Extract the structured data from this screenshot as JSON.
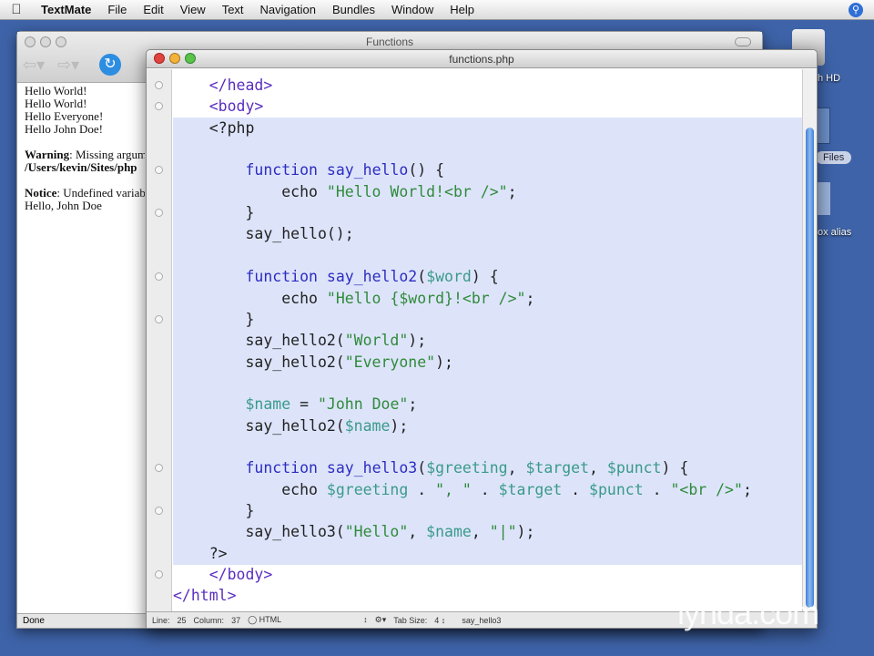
{
  "menubar": {
    "apple": "",
    "app": "TextMate",
    "items": [
      "File",
      "Edit",
      "View",
      "Text",
      "Navigation",
      "Bundles",
      "Window",
      "Help"
    ]
  },
  "desktop": {
    "hd_label": "h HD",
    "files_label": "Files",
    "alias_label": "ox alias"
  },
  "browser": {
    "title": "Functions",
    "status": "Done",
    "lines": [
      "Hello World!",
      "Hello World!",
      "Hello Everyone!",
      "Hello John Doe!"
    ],
    "warning_label": "Warning",
    "warning_text": ": Missing argument",
    "warning_path": "/Users/kevin/Sites/php",
    "notice_label": "Notice",
    "notice_text": ": Undefined variable",
    "final": "Hello, John Doe"
  },
  "editor": {
    "title": "functions.php",
    "status": {
      "line_label": "Line:",
      "line": "25",
      "col_label": "Column:",
      "col": "37",
      "lang": "HTML",
      "tab_label": "Tab Size:",
      "tab": "4",
      "symbol": "say_hello3"
    },
    "code": [
      [
        [
          "    ",
          "txt"
        ],
        [
          "</head>",
          "tag"
        ]
      ],
      [
        [
          "    ",
          "txt"
        ],
        [
          "<body>",
          "tag"
        ]
      ],
      [
        [
          "    <?php",
          "txt"
        ]
      ],
      [],
      [
        [
          "        ",
          "txt"
        ],
        [
          "function",
          "kw"
        ],
        [
          " ",
          "txt"
        ],
        [
          "say_hello",
          "fn"
        ],
        [
          "() {",
          "txt"
        ]
      ],
      [
        [
          "            echo ",
          "txt"
        ],
        [
          "\"Hello World!<br />\"",
          "str"
        ],
        [
          ";",
          "txt"
        ]
      ],
      [
        [
          "        }",
          "txt"
        ]
      ],
      [
        [
          "        say_hello();",
          "txt"
        ]
      ],
      [],
      [
        [
          "        ",
          "txt"
        ],
        [
          "function",
          "kw"
        ],
        [
          " ",
          "txt"
        ],
        [
          "say_hello2",
          "fn"
        ],
        [
          "(",
          "txt"
        ],
        [
          "$word",
          "var"
        ],
        [
          ") {",
          "txt"
        ]
      ],
      [
        [
          "            echo ",
          "txt"
        ],
        [
          "\"Hello {$word}!<br />\"",
          "str"
        ],
        [
          ";",
          "txt"
        ]
      ],
      [
        [
          "        }",
          "txt"
        ]
      ],
      [
        [
          "        say_hello2(",
          "txt"
        ],
        [
          "\"World\"",
          "str"
        ],
        [
          ");",
          "txt"
        ]
      ],
      [
        [
          "        say_hello2(",
          "txt"
        ],
        [
          "\"Everyone\"",
          "str"
        ],
        [
          ");",
          "txt"
        ]
      ],
      [],
      [
        [
          "        ",
          "txt"
        ],
        [
          "$name",
          "var"
        ],
        [
          " = ",
          "txt"
        ],
        [
          "\"John Doe\"",
          "str"
        ],
        [
          ";",
          "txt"
        ]
      ],
      [
        [
          "        say_hello2(",
          "txt"
        ],
        [
          "$name",
          "var"
        ],
        [
          ");",
          "txt"
        ]
      ],
      [],
      [
        [
          "        ",
          "txt"
        ],
        [
          "function",
          "kw"
        ],
        [
          " ",
          "txt"
        ],
        [
          "say_hello3",
          "fn"
        ],
        [
          "(",
          "txt"
        ],
        [
          "$greeting",
          "var"
        ],
        [
          ", ",
          "txt"
        ],
        [
          "$target",
          "var"
        ],
        [
          ", ",
          "txt"
        ],
        [
          "$punct",
          "var"
        ],
        [
          ") {",
          "txt"
        ]
      ],
      [
        [
          "            echo ",
          "txt"
        ],
        [
          "$greeting",
          "var"
        ],
        [
          " . ",
          "txt"
        ],
        [
          "\", \"",
          "str"
        ],
        [
          " . ",
          "txt"
        ],
        [
          "$target",
          "var"
        ],
        [
          " . ",
          "txt"
        ],
        [
          "$punct",
          "var"
        ],
        [
          " . ",
          "txt"
        ],
        [
          "\"<br />\"",
          "str"
        ],
        [
          ";",
          "txt"
        ]
      ],
      [
        [
          "        }",
          "txt"
        ]
      ],
      [
        [
          "        say_hello3(",
          "txt"
        ],
        [
          "\"Hello\"",
          "str"
        ],
        [
          ", ",
          "txt"
        ],
        [
          "$name",
          "var"
        ],
        [
          ", ",
          "txt"
        ],
        [
          "\"|\"",
          "str"
        ],
        [
          ");",
          "txt"
        ]
      ],
      [
        [
          "    ?>",
          "txt"
        ]
      ],
      [
        [
          "    ",
          "txt"
        ],
        [
          "</body>",
          "tag"
        ]
      ],
      [
        [
          "",
          "txt"
        ],
        [
          "</html>",
          "tag"
        ]
      ]
    ]
  },
  "watermark": "lynda.com"
}
